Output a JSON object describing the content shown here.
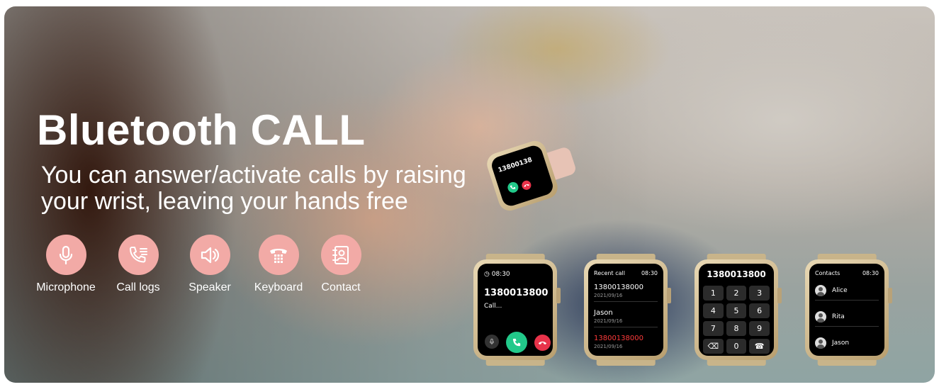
{
  "banner": {
    "title": "Bluetooth CALL",
    "subtitle": "You can answer/activate calls by raising your wrist, leaving your hands free"
  },
  "features": [
    {
      "label": "Microphone",
      "icon": "microphone-icon"
    },
    {
      "label": "Call logs",
      "icon": "call-logs-icon"
    },
    {
      "label": "Speaker",
      "icon": "speaker-icon"
    },
    {
      "label": "Keyboard",
      "icon": "keypad-phone-icon"
    },
    {
      "label": "Contact",
      "icon": "contact-book-icon"
    }
  ],
  "colors": {
    "feature_circle": "#f2aaa6",
    "answer_green": "#22c98a",
    "hangup_red": "#e8334a",
    "missed_red": "#ff3b3b"
  },
  "wrist_watch": {
    "number": "13800138",
    "answer_icon": "phone-answer-icon",
    "hangup_icon": "phone-hangup-icon"
  },
  "watch_calling": {
    "time": "08:30",
    "number": "1380013800",
    "status": "Call..."
  },
  "watch_recent": {
    "title": "Recent call",
    "time": "08:30",
    "entries": [
      {
        "name": "13800138000",
        "date": "2021/09/16",
        "missed": false
      },
      {
        "name": "Jason",
        "date": "2021/09/16",
        "missed": false
      },
      {
        "name": "13800138000",
        "date": "2021/09/16",
        "missed": true
      }
    ]
  },
  "watch_keypad": {
    "number": "1380013800",
    "keys": [
      "1",
      "2",
      "3",
      "4",
      "5",
      "6",
      "7",
      "8",
      "9",
      "⌫",
      "0",
      "☎"
    ]
  },
  "watch_contacts": {
    "title": "Contacts",
    "time": "08:30",
    "names": [
      "Alice",
      "Rita",
      "Jason"
    ]
  }
}
